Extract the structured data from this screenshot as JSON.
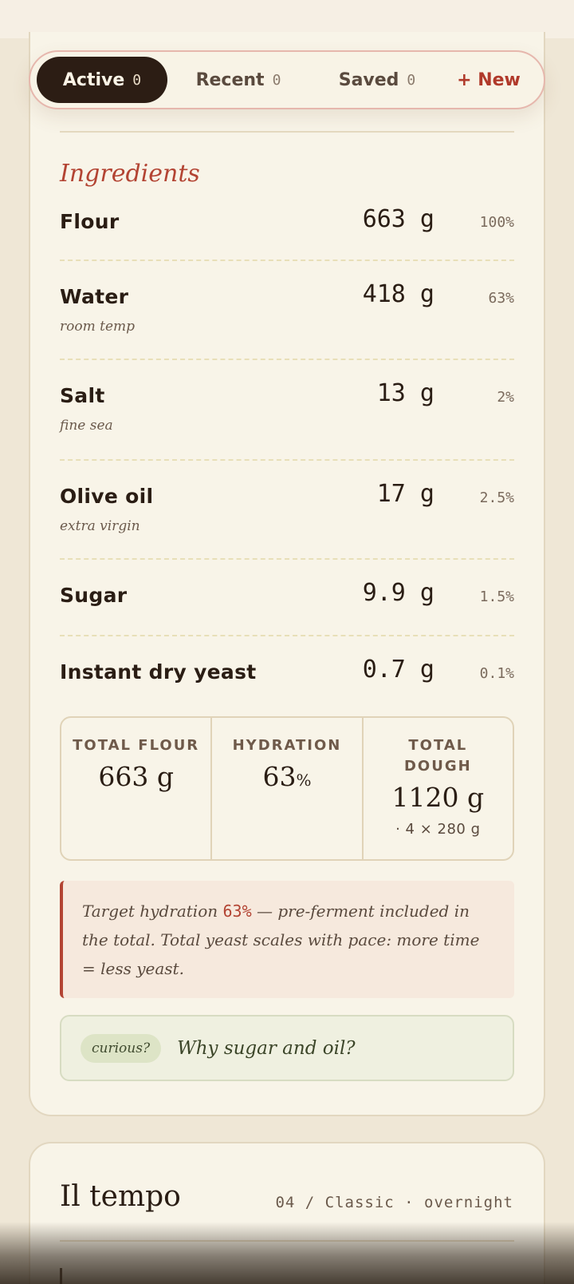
{
  "tabs": [
    {
      "label": "Active",
      "count": "0"
    },
    {
      "label": "Recent",
      "count": "0"
    },
    {
      "label": "Saved",
      "count": "0"
    },
    {
      "label": "+ New"
    }
  ],
  "ingredients": {
    "title": "Ingredients",
    "items": [
      {
        "name": "Flour",
        "note": "",
        "qty": "663 g",
        "pct": "100%"
      },
      {
        "name": "Water",
        "note": "room temp",
        "qty": "418 g",
        "pct": "63%"
      },
      {
        "name": "Salt",
        "note": "fine sea",
        "qty": "13 g",
        "pct": "2%"
      },
      {
        "name": "Olive oil",
        "note": "extra virgin",
        "qty": "17 g",
        "pct": "2.5%"
      },
      {
        "name": "Sugar",
        "note": "",
        "qty": "9.9 g",
        "pct": "1.5%"
      },
      {
        "name": "Instant dry yeast",
        "note": "",
        "qty": "0.7 g",
        "pct": "0.1%"
      }
    ]
  },
  "totals": {
    "flour": {
      "label": "TOTAL FLOUR",
      "value": "663 g"
    },
    "hydration": {
      "label": "HYDRATION",
      "value": "63",
      "unit": "%"
    },
    "dough": {
      "label": "TOTAL DOUGH",
      "value": "1120 g",
      "sub": "· 4 × 280 g"
    }
  },
  "note": {
    "prefix": "Target hydration ",
    "highlight": "63%",
    "suffix": " — pre-ferment included in the total. Total yeast scales with pace: more time = less yeast."
  },
  "curious": {
    "tag": "curious?",
    "question": "Why sugar and oil?"
  },
  "tempo": {
    "title": "Il tempo",
    "meta": "04 / Classic · overnight"
  },
  "colors": {
    "accent": "#b34433",
    "dark": "#2c1d14",
    "card": "#f8f4e8",
    "background": "#efe7d6"
  }
}
